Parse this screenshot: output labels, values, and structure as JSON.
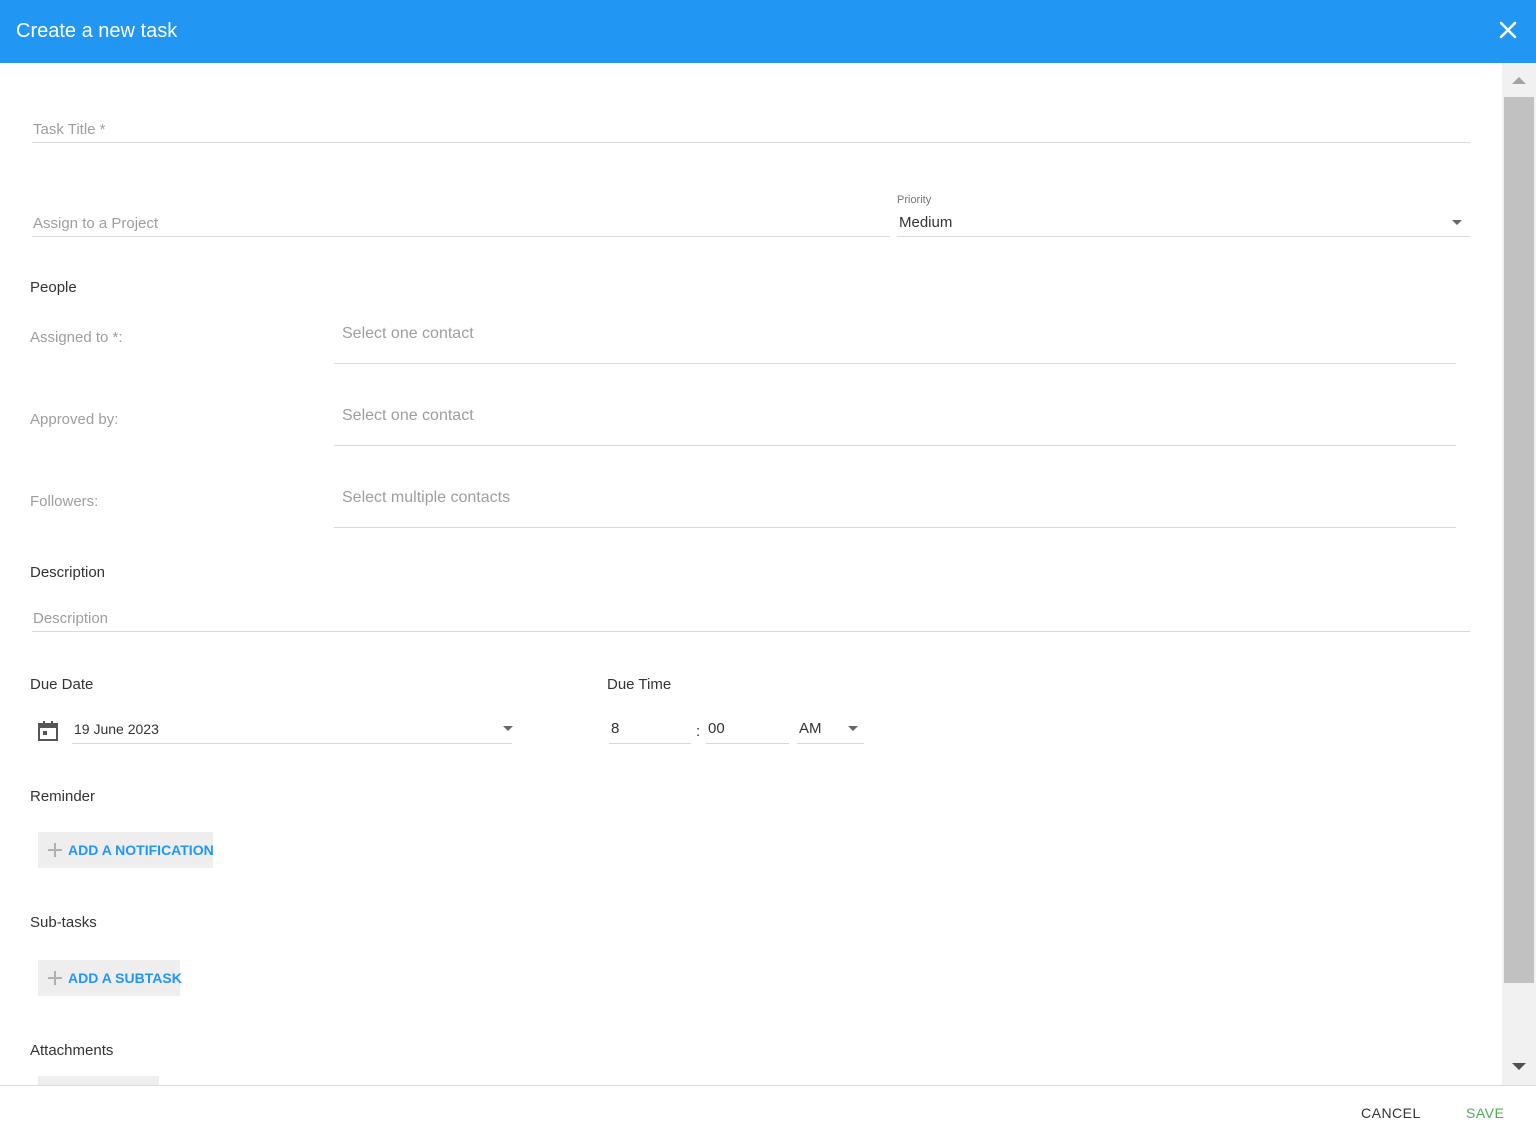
{
  "dialog": {
    "title": "Create a new task",
    "cancel_label": "CANCEL",
    "save_label": "SAVE"
  },
  "fields": {
    "task_title_placeholder": "Task Title *",
    "project_placeholder": "Assign to a Project",
    "priority_label": "Priority",
    "priority_value": "Medium"
  },
  "people": {
    "heading": "People",
    "assigned_label": "Assigned to *:",
    "assigned_placeholder": "Select one contact",
    "approved_label": "Approved by:",
    "approved_placeholder": "Select one contact",
    "followers_label": "Followers:",
    "followers_placeholder": "Select multiple contacts"
  },
  "description": {
    "heading": "Description",
    "placeholder": "Description"
  },
  "due": {
    "date_heading": "Due Date",
    "date_value": "19 June 2023",
    "time_heading": "Due Time",
    "hour": "8",
    "separator": ":",
    "minute": "00",
    "ampm": "AM"
  },
  "reminder": {
    "heading": "Reminder",
    "button": "ADD A NOTIFICATION"
  },
  "subtasks": {
    "heading": "Sub-tasks",
    "button": "ADD A SUBTASK"
  },
  "attachments": {
    "heading": "Attachments"
  },
  "colors": {
    "header": "#2196f3",
    "link": "#2196f3",
    "save": "#4caf50"
  }
}
